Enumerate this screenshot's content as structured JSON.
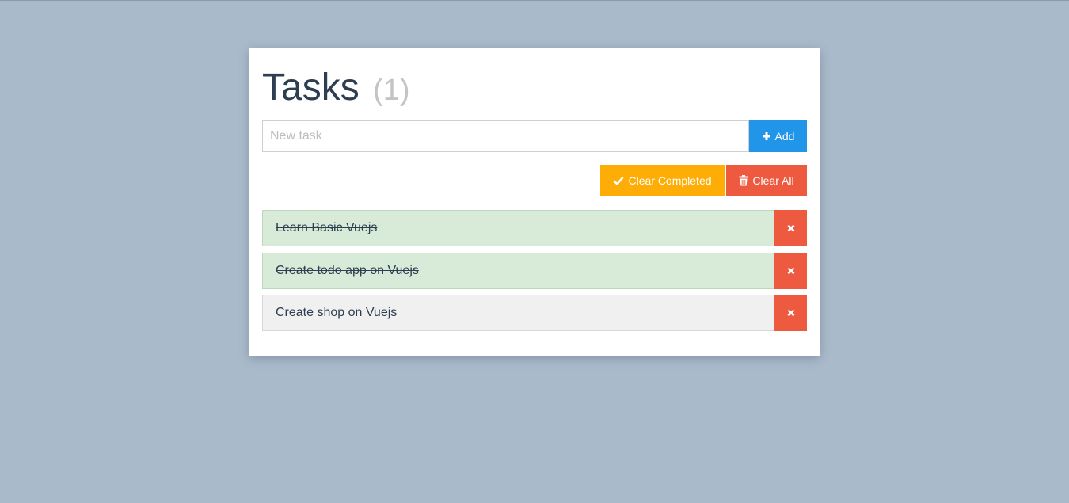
{
  "header": {
    "title": "Tasks",
    "count": "(1)"
  },
  "new_task": {
    "placeholder": "New task",
    "value": ""
  },
  "buttons": {
    "add_label": "Add",
    "clear_completed_label": "Clear Completed",
    "clear_all_label": "Clear All"
  },
  "tasks": [
    {
      "text": "Learn Basic Vuejs",
      "completed": true
    },
    {
      "text": "Create todo app on Vuejs",
      "completed": true
    },
    {
      "text": "Create shop on Vuejs",
      "completed": false
    }
  ],
  "colors": {
    "background": "#a9bacb",
    "primary": "#2196e8",
    "warning": "#fdad06",
    "danger": "#ee5a40",
    "completed_bg": "#d8ebd8",
    "pending_bg": "#f0f0f0",
    "text": "#2c3e50"
  },
  "icons": {
    "add": "plus-icon",
    "clear_completed": "check-icon",
    "clear_all": "trash-icon",
    "remove": "close-icon"
  }
}
